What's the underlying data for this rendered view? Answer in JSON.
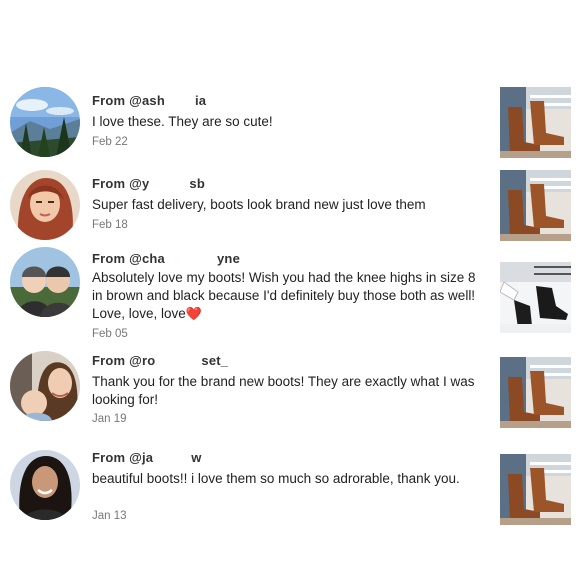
{
  "reviews": [
    {
      "from_prefix": "From @ash",
      "from_suffix": "ia",
      "text": "I love these. They are so cute!",
      "date": "Feb 22",
      "avatar_icon": "mountain-landscape-photo",
      "thumb_icon": "brown-boots-photo"
    },
    {
      "from_prefix": "From @y",
      "from_suffix": "sb",
      "text": "Super fast delivery, boots look brand new just love them",
      "date": "Feb 18",
      "avatar_icon": "red-haired-woman-photo",
      "thumb_icon": "brown-boots-photo"
    },
    {
      "from_prefix": "From @cha",
      "from_suffix": "yne",
      "text": "Absolutely love my boots! Wish you had the knee highs in size 8 in brown and black because I'd definitely buy those both as well! Love, love, love",
      "heart": "❤️",
      "date": "Feb 05",
      "avatar_icon": "two-women-snow-photo",
      "thumb_icon": "black-boots-snow-photo"
    },
    {
      "from_prefix": "From @ro",
      "from_suffix": "set_",
      "text": "Thank you for the brand new boots! They are exactly what I was looking for!",
      "date": "Jan 19",
      "avatar_icon": "woman-with-baby-photo",
      "thumb_icon": "brown-boots-photo"
    },
    {
      "from_prefix": "From @ja",
      "from_suffix": "w",
      "text": "beautiful boots!! i love them so much so adrorable, thank you.",
      "date": "Jan 13",
      "avatar_icon": "dark-haired-woman-photo",
      "thumb_icon": "brown-boots-photo"
    }
  ]
}
